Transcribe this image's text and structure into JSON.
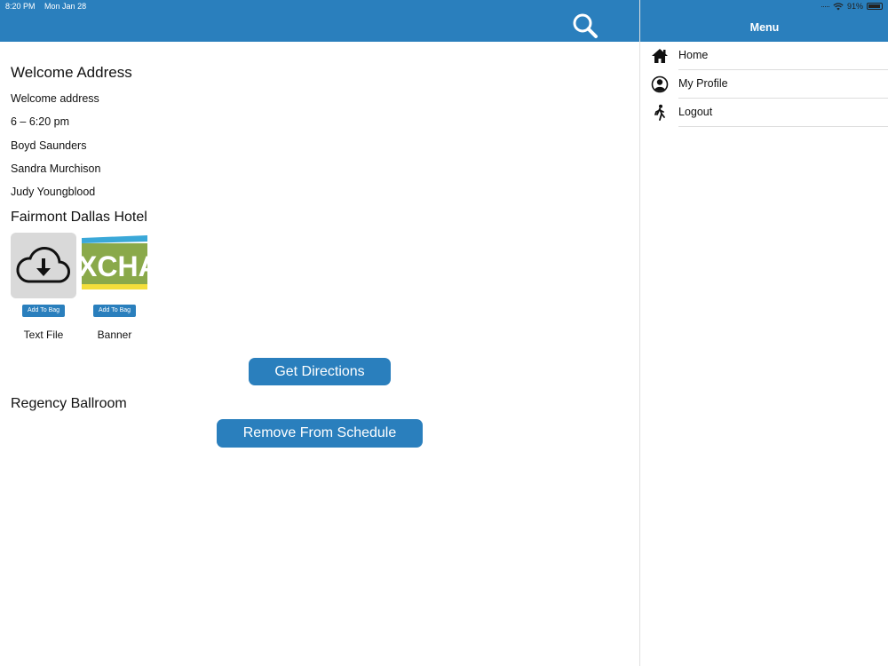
{
  "status_bar": {
    "time": "8:20 PM",
    "date": "Mon Jan 28",
    "battery": "91%",
    "battery_level": 0.91
  },
  "header": {
    "search_icon": "search-icon"
  },
  "session": {
    "title": "Welcome Address",
    "description": "Welcome address",
    "time": "6 – 6:20 pm",
    "speakers": [
      "Boyd Saunders",
      "Sandra Murchison",
      "Judy Youngblood"
    ],
    "venue": "Fairmont Dallas Hotel",
    "room": "Regency Ballroom"
  },
  "attachments": [
    {
      "label": "Text File",
      "button": "Add To Bag",
      "icon": "cloud-download-icon"
    },
    {
      "label": "Banner",
      "button": "Add To Bag",
      "banner_text": "XCHAN"
    }
  ],
  "actions": {
    "directions": "Get Directions",
    "remove": "Remove From Schedule"
  },
  "menu": {
    "title": "Menu",
    "items": [
      {
        "label": "Home",
        "icon": "home-icon"
      },
      {
        "label": "My Profile",
        "icon": "profile-icon"
      },
      {
        "label": "Logout",
        "icon": "walking-person-icon"
      }
    ]
  },
  "colors": {
    "brand": "#2a7fbd",
    "banner_green": "#8aa94a",
    "banner_yellow": "#f3de3b",
    "banner_blue": "#3aa8d8"
  }
}
